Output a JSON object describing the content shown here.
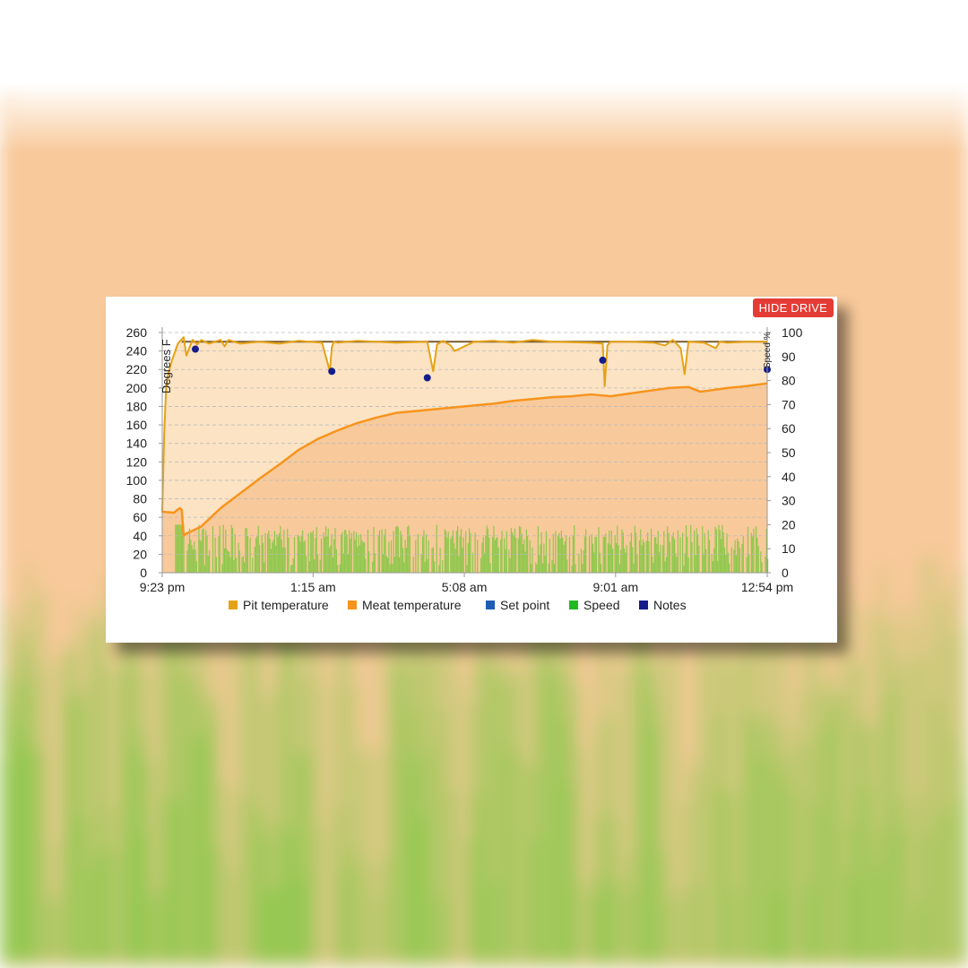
{
  "button": {
    "hide_drive": "HIDE DRIVE"
  },
  "chart_data": {
    "type": "line",
    "ylabel": "Degrees F",
    "y2label": "Speed %",
    "ylim": [
      0,
      260
    ],
    "y2lim": [
      0,
      100
    ],
    "yticks": [
      0,
      20,
      40,
      60,
      80,
      100,
      120,
      140,
      160,
      180,
      200,
      220,
      240,
      260
    ],
    "y2ticks": [
      0,
      10,
      20,
      30,
      40,
      50,
      60,
      70,
      80,
      90,
      100
    ],
    "xlim_hours": [
      0,
      15.52
    ],
    "xticks": [
      {
        "t": 0,
        "label": "9:23 pm"
      },
      {
        "t": 3.87,
        "label": "1:15 am"
      },
      {
        "t": 7.75,
        "label": "5:08 am"
      },
      {
        "t": 11.63,
        "label": "9:01 am"
      },
      {
        "t": 15.52,
        "label": "12:54 pm"
      }
    ],
    "grid": true,
    "legend": "bottom",
    "legend_items": [
      {
        "name": "Pit temperature",
        "color": "#e6a216"
      },
      {
        "name": "Meat temperature",
        "color": "#f7941d"
      },
      {
        "name": "Set point",
        "color": "#1f5db5"
      },
      {
        "name": "Speed",
        "color": "#22b822"
      },
      {
        "name": "Notes",
        "color": "#151d8c"
      }
    ],
    "series": [
      {
        "name": "Pit temperature",
        "x": [
          0,
          0.05,
          0.1,
          0.15,
          0.25,
          0.4,
          0.55,
          0.62,
          0.7,
          0.78,
          0.9,
          1.0,
          1.2,
          1.5,
          1.6,
          1.7,
          2.0,
          2.5,
          3.0,
          3.5,
          4.1,
          4.3,
          4.35,
          4.4,
          4.5,
          5.0,
          6.0,
          6.8,
          6.95,
          7.05,
          7.2,
          7.4,
          7.5,
          8.0,
          8.5,
          9.0,
          9.5,
          10.0,
          11.0,
          11.3,
          11.35,
          11.42,
          11.5,
          12.0,
          12.6,
          12.9,
          13.1,
          13.3,
          13.4,
          13.5,
          13.9,
          14.2,
          14.3,
          14.5,
          15.0,
          15.52
        ],
        "y": [
          65,
          150,
          200,
          215,
          230,
          248,
          255,
          235,
          244,
          252,
          247,
          252,
          248,
          252,
          245,
          252,
          248,
          250,
          248,
          251,
          249,
          218,
          244,
          250,
          249,
          251,
          249,
          250,
          218,
          247,
          251,
          246,
          240,
          250,
          251,
          249,
          252,
          250,
          249,
          248,
          202,
          246,
          250,
          250,
          249,
          246,
          252,
          243,
          215,
          250,
          249,
          243,
          250,
          249,
          250,
          250
        ]
      },
      {
        "name": "Meat temperature",
        "x": [
          0,
          0.3,
          0.45,
          0.5,
          0.55,
          0.6,
          1.0,
          1.5,
          2.0,
          2.5,
          3.0,
          3.5,
          4.0,
          4.5,
          5.0,
          5.5,
          6.0,
          6.5,
          7.0,
          7.5,
          8.0,
          8.5,
          9.0,
          9.5,
          10.0,
          10.5,
          11.0,
          11.5,
          12.0,
          12.5,
          13.0,
          13.5,
          13.8,
          14.0,
          14.5,
          15.0,
          15.52
        ],
        "y": [
          66,
          65,
          70,
          68,
          40,
          42,
          50,
          70,
          86,
          102,
          117,
          133,
          145,
          154,
          162,
          168,
          173,
          175,
          177,
          179,
          181,
          183,
          186,
          188,
          190,
          191,
          193,
          191,
          194,
          197,
          200,
          201,
          196,
          197,
          200,
          202,
          205
        ]
      },
      {
        "name": "Set point",
        "x": [
          0.5,
          15.52
        ],
        "y": [
          250,
          250
        ]
      }
    ],
    "notes": [
      {
        "t": 0.85,
        "y": 242
      },
      {
        "t": 4.35,
        "y": 218
      },
      {
        "t": 6.8,
        "y": 211
      },
      {
        "t": 11.3,
        "y": 230
      },
      {
        "t": 15.52,
        "y": 220
      }
    ],
    "speed_style": "dense green bars, roughly 0–20 % across the cook, peaks near 20 %"
  }
}
